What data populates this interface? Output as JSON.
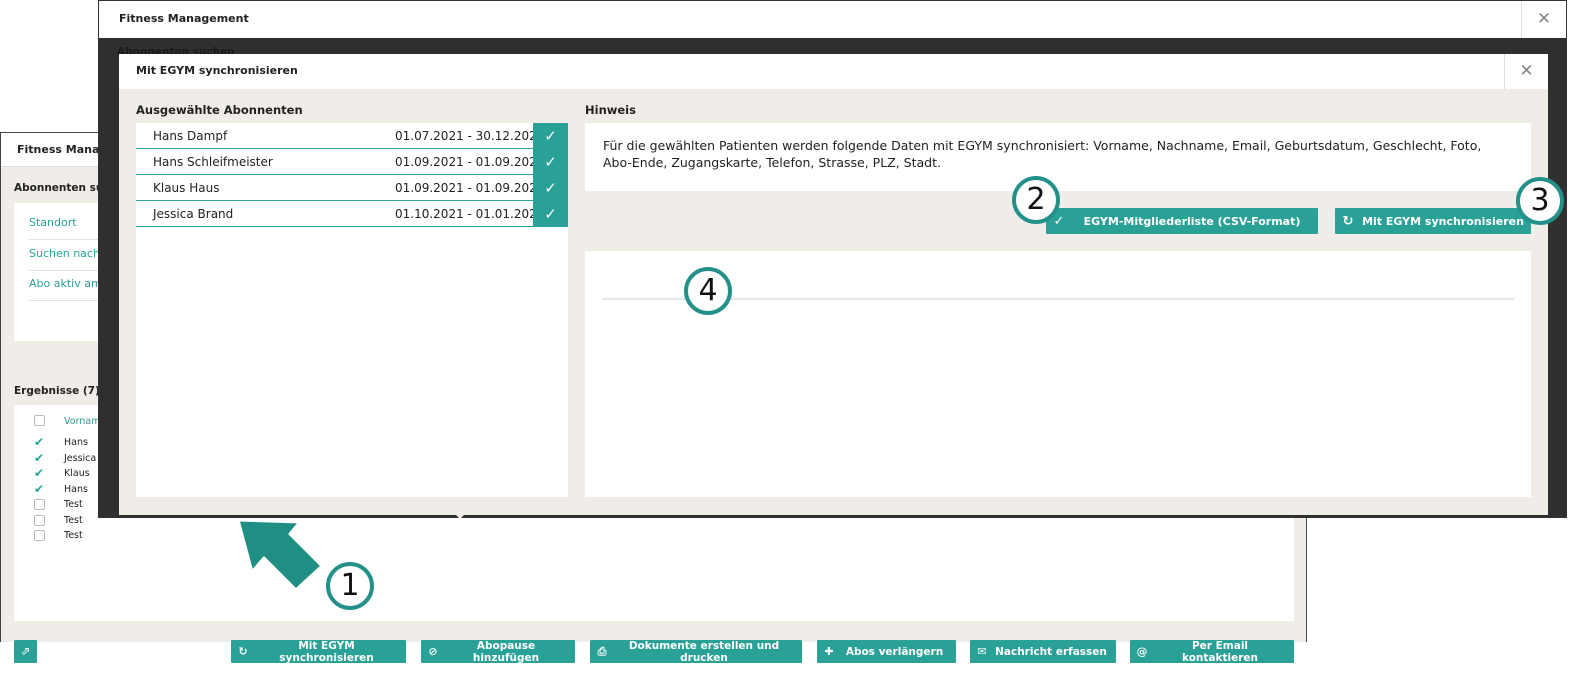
{
  "background_window": {
    "title": "Fitness Managem",
    "search_header": "Abonnenten such",
    "fields": [
      "Standort",
      "Suchen nach",
      "Abo aktiv am"
    ],
    "side_letter": "E",
    "results_header": "Ergebnisse (7)",
    "column_header": "Vorname",
    "rows": [
      {
        "name": "Hans",
        "checked": true
      },
      {
        "name": "Jessica",
        "checked": true
      },
      {
        "name": "Klaus",
        "checked": true
      },
      {
        "name": "Hans",
        "checked": true
      },
      {
        "name": "Test",
        "checked": false
      },
      {
        "name": "Test",
        "checked": false
      },
      {
        "name": "Test",
        "checked": false
      }
    ],
    "footer_buttons": [
      {
        "label": "Mit EGYM synchronisieren",
        "icon": "sync-icon"
      },
      {
        "label": "Abopause hinzufügen",
        "icon": "pause-icon"
      },
      {
        "label": "Dokumente erstellen und drucken",
        "icon": "printer-icon"
      },
      {
        "label": "Abos verlängern",
        "icon": "plus-icon"
      },
      {
        "label": "Nachricht erfassen",
        "icon": "envelope-icon"
      },
      {
        "label": "Per Email kontaktieren",
        "icon": "at-icon"
      }
    ]
  },
  "foreground_window": {
    "title": "Fitness Management",
    "obscured_text": "Abonnenten suchen"
  },
  "dialog": {
    "title": "Mit EGYM synchronisieren",
    "selected_label": "Ausgewählte Abonnenten",
    "hint_label": "Hinweis",
    "subscribers": [
      {
        "name": "Hans Dampf",
        "period": "01.07.2021 - 30.12.2021"
      },
      {
        "name": "Hans Schleifmeister",
        "period": "01.09.2021 - 01.09.2022"
      },
      {
        "name": "Klaus Haus",
        "period": "01.09.2021 - 01.09.2022"
      },
      {
        "name": "Jessica Brand",
        "period": "01.10.2021 - 01.01.2022"
      }
    ],
    "hint_text": "Für die gewählten Patienten werden folgende Daten mit EGYM synchronisiert: Vorname, Nachname, Email, Geburtsdatum, Geschlecht, Foto, Abo-Ende, Zugangskarte, Telefon, Strasse, PLZ, Stadt.",
    "csv_button": "EGYM-Mitgliederliste (CSV-Format)",
    "sync_button": "Mit EGYM synchronisieren"
  },
  "annotations": [
    "1",
    "2",
    "3",
    "4"
  ],
  "colors": {
    "accent": "#2aa197",
    "badge_ring": "#23918a",
    "arrow": "#1f8f86"
  }
}
